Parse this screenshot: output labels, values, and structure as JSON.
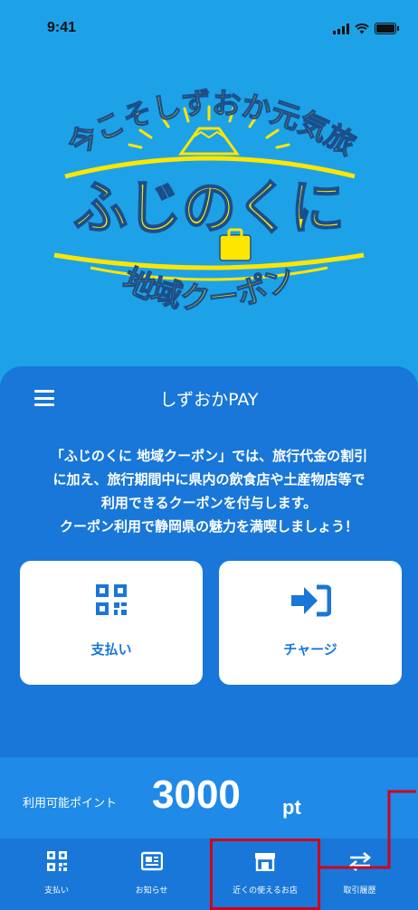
{
  "status_bar": {
    "time": "9:41"
  },
  "logo": {
    "arc_text": "今こそしずおか元気旅",
    "main_text": "ふじのくに",
    "sub_text": "地域クーポン"
  },
  "panel": {
    "title": "しずおかPAY",
    "description": [
      "「ふじのくに 地域クーポン」では、旅行代金の割引",
      "に加え、旅行期間中に県内の飲食店や土産物店等で",
      "利用できるクーポンを付与します。",
      "クーポン利用で静岡県の魅力を満喫しましょう！"
    ],
    "pay_label": "支払い",
    "charge_label": "チャージ"
  },
  "points": {
    "label": "利用可能ポイント",
    "value": "3000",
    "unit": "pt"
  },
  "nav": {
    "items": [
      {
        "label": "支払い",
        "icon": "qr-code-icon"
      },
      {
        "label": "お知らせ",
        "icon": "news-icon"
      },
      {
        "label": "近くの使えるお店",
        "icon": "store-icon"
      },
      {
        "label": "取引履歴",
        "icon": "transfer-arrows-icon"
      }
    ]
  },
  "colors": {
    "background": "#1da2e8",
    "panel": "#1877d8",
    "logo_yellow": "#ffe600",
    "highlight": "#d0021b"
  }
}
